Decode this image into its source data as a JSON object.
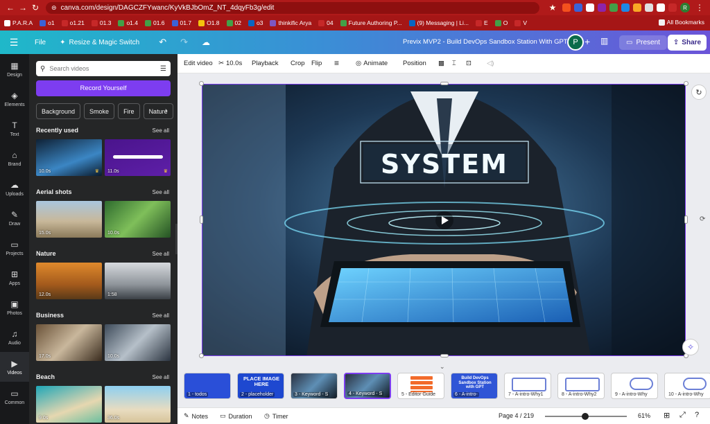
{
  "browser": {
    "url": "canva.com/design/DAGCZFYwanc/KyVkBJbOmZ_NT_4dqyFb3g/edit",
    "profile_initial": "R",
    "bookmarks": [
      {
        "label": "P.A.R.A",
        "color": "#ffffff"
      },
      {
        "label": "o1",
        "color": "#3b62d6"
      },
      {
        "label": "o1.21",
        "color": "#c62828"
      },
      {
        "label": "01.3",
        "color": "#c62828"
      },
      {
        "label": "o1.4",
        "color": "#43a047"
      },
      {
        "label": "01.6",
        "color": "#43a047"
      },
      {
        "label": "01.7",
        "color": "#3b62d6"
      },
      {
        "label": "O1.8",
        "color": "#f4c20d"
      },
      {
        "label": "02",
        "color": "#43a047"
      },
      {
        "label": "o3",
        "color": "#0a66c2"
      },
      {
        "label": "thinkific Arya",
        "color": "#7e57c2"
      },
      {
        "label": "04",
        "color": "#c62828"
      },
      {
        "label": "Future Authoring P...",
        "color": "#43a047"
      },
      {
        "label": "(9) Messaging | Li...",
        "color": "#0a66c2"
      },
      {
        "label": "E",
        "color": "#c62828"
      },
      {
        "label": "O",
        "color": "#43a047"
      },
      {
        "label": "V",
        "color": "#c62828"
      }
    ],
    "all_bookmarks": "All Bookmarks"
  },
  "header": {
    "file": "File",
    "resize": "Resize & Magic Switch",
    "title": "Previx MVP2 - Build DevOps Sandbox Station  With GPT",
    "user_initial": "P",
    "present": "Present",
    "share": "Share"
  },
  "rail": [
    {
      "label": "Design",
      "icon": "▦"
    },
    {
      "label": "Elements",
      "icon": "◈"
    },
    {
      "label": "Text",
      "icon": "T"
    },
    {
      "label": "Brand",
      "icon": "⌂"
    },
    {
      "label": "Uploads",
      "icon": "☁"
    },
    {
      "label": "Draw",
      "icon": "✎"
    },
    {
      "label": "Projects",
      "icon": "▭"
    },
    {
      "label": "Apps",
      "icon": "⊞"
    },
    {
      "label": "Photos",
      "icon": "▣"
    },
    {
      "label": "Audio",
      "icon": "♫"
    },
    {
      "label": "Videos",
      "icon": "▶"
    },
    {
      "label": "Common",
      "icon": "▭"
    }
  ],
  "panel": {
    "search_placeholder": "Search videos",
    "record": "Record Yourself",
    "chips": [
      "Background",
      "Smoke",
      "Fire",
      "Nature"
    ],
    "see_all": "See all",
    "sections": [
      {
        "title": "Recently used",
        "durations": [
          "10.0s",
          "11.0s"
        ]
      },
      {
        "title": "Aerial shots",
        "durations": [
          "15.0s",
          "10.0s"
        ]
      },
      {
        "title": "Nature",
        "durations": [
          "12.0s",
          "1:58"
        ]
      },
      {
        "title": "Business",
        "durations": [
          "17.0s",
          "10.0s"
        ]
      },
      {
        "title": "Beach",
        "durations": [
          "9.0s",
          "36.0s"
        ]
      }
    ]
  },
  "toolbar": {
    "edit_video": "Edit video",
    "duration": "10.0s",
    "playback": "Playback",
    "crop": "Crop",
    "flip": "Flip",
    "animate": "Animate",
    "position": "Position"
  },
  "slide": {
    "headline": "SYSTEM"
  },
  "filmstrip": [
    {
      "label": "1 - todos",
      "text": "",
      "bg": "#2a4fd8",
      "dark": true
    },
    {
      "label": "2 - placeholder",
      "text": "PLACE IMAGE HERE",
      "bg": "#1e48d0",
      "dark": true
    },
    {
      "label": "3 - Keyword - S",
      "text": "",
      "bg": "#3a3a48",
      "dark": true
    },
    {
      "label": "4 - Keyword - S",
      "text": "",
      "bg": "#1f3b57",
      "dark": true
    },
    {
      "label": "5 - Editor Guide",
      "text": "",
      "bg": "#ffffff",
      "dark": false
    },
    {
      "label": "6 - A-intro-",
      "text": "Build DevOps Sandbox Station with GPT",
      "bg": "#2f55d6",
      "dark": true
    },
    {
      "label": "7 - A-intro-Why1",
      "text": "",
      "bg": "#ffffff",
      "dark": false
    },
    {
      "label": "8 - A-intro-Why2",
      "text": "",
      "bg": "#ffffff",
      "dark": false
    },
    {
      "label": "9 - A-intro-Why",
      "text": "",
      "bg": "#ffffff",
      "dark": false
    },
    {
      "label": "10 - A-intro-Why",
      "text": "",
      "bg": "#ffffff",
      "dark": false
    }
  ],
  "bottombar": {
    "notes": "Notes",
    "duration": "Duration",
    "timer": "Timer",
    "page": "Page 4 / 219",
    "zoom": "61%",
    "zoom_level": 0.61
  },
  "colors": {
    "accent": "#7d3df0",
    "browser": "#b01a1a"
  }
}
